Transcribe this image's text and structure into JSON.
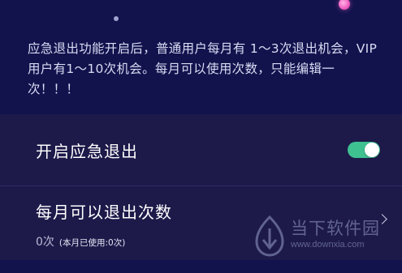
{
  "notice": {
    "text": "应急退出功能开启后，普通用户每月有 1～3次退出机会，VIP用户有1～10次机会。每月可以使用次数，只能编辑一次！！！"
  },
  "settings": {
    "emergency_exit": {
      "label": "开启应急退出",
      "enabled": true,
      "accent_color": "#3fc091"
    },
    "monthly_exits": {
      "title": "每月可以退出次数",
      "value": "0次",
      "used": "(本月已使用:0次)"
    }
  },
  "watermark": {
    "name": "当下软件园",
    "url": "www.downxia.com"
  },
  "colors": {
    "background": "#12134d",
    "panel": "#1d1a4a"
  }
}
